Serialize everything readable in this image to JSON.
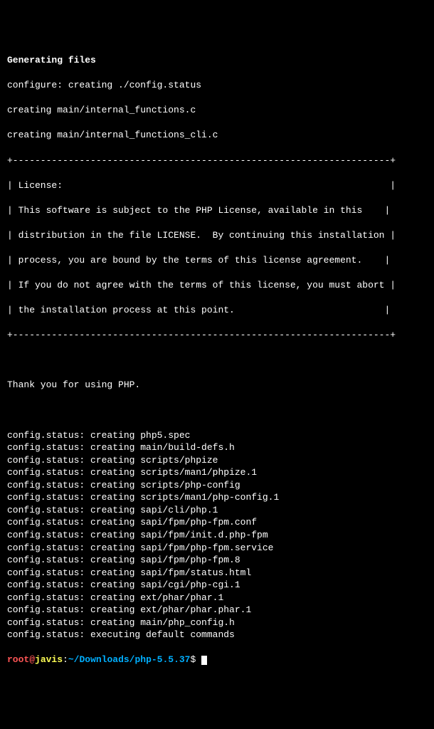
{
  "header": {
    "title": "Generating files",
    "configure_line": "configure: creating ./config.status",
    "creating_1": "creating main/internal_functions.c",
    "creating_2": "creating main/internal_functions_cli.c"
  },
  "box": {
    "top": "+--------------------------------------------------------------------+",
    "l1": "| License:                                                           |",
    "l2": "| This software is subject to the PHP License, available in this    |",
    "l3": "| distribution in the file LICENSE.  By continuing this installation |",
    "l4": "| process, you are bound by the terms of this license agreement.    |",
    "l5": "| If you do not agree with the terms of this license, you must abort |",
    "l6": "| the installation process at this point.                           |",
    "bottom": "+--------------------------------------------------------------------+"
  },
  "thanks": "Thank you for using PHP.",
  "config_status": [
    "config.status: creating php5.spec",
    "config.status: creating main/build-defs.h",
    "config.status: creating scripts/phpize",
    "config.status: creating scripts/man1/phpize.1",
    "config.status: creating scripts/php-config",
    "config.status: creating scripts/man1/php-config.1",
    "config.status: creating sapi/cli/php.1",
    "config.status: creating sapi/fpm/php-fpm.conf",
    "config.status: creating sapi/fpm/init.d.php-fpm",
    "config.status: creating sapi/fpm/php-fpm.service",
    "config.status: creating sapi/fpm/php-fpm.8",
    "config.status: creating sapi/fpm/status.html",
    "config.status: creating sapi/cgi/php-cgi.1",
    "config.status: creating ext/phar/phar.1",
    "config.status: creating ext/phar/phar.phar.1",
    "config.status: creating main/php_config.h",
    "config.status: executing default commands"
  ],
  "prompt": {
    "user": "root",
    "at": "@",
    "host": "javis",
    "colon": ":",
    "path": "~/Downloads/php-5.5.37",
    "dollar": "$ "
  }
}
